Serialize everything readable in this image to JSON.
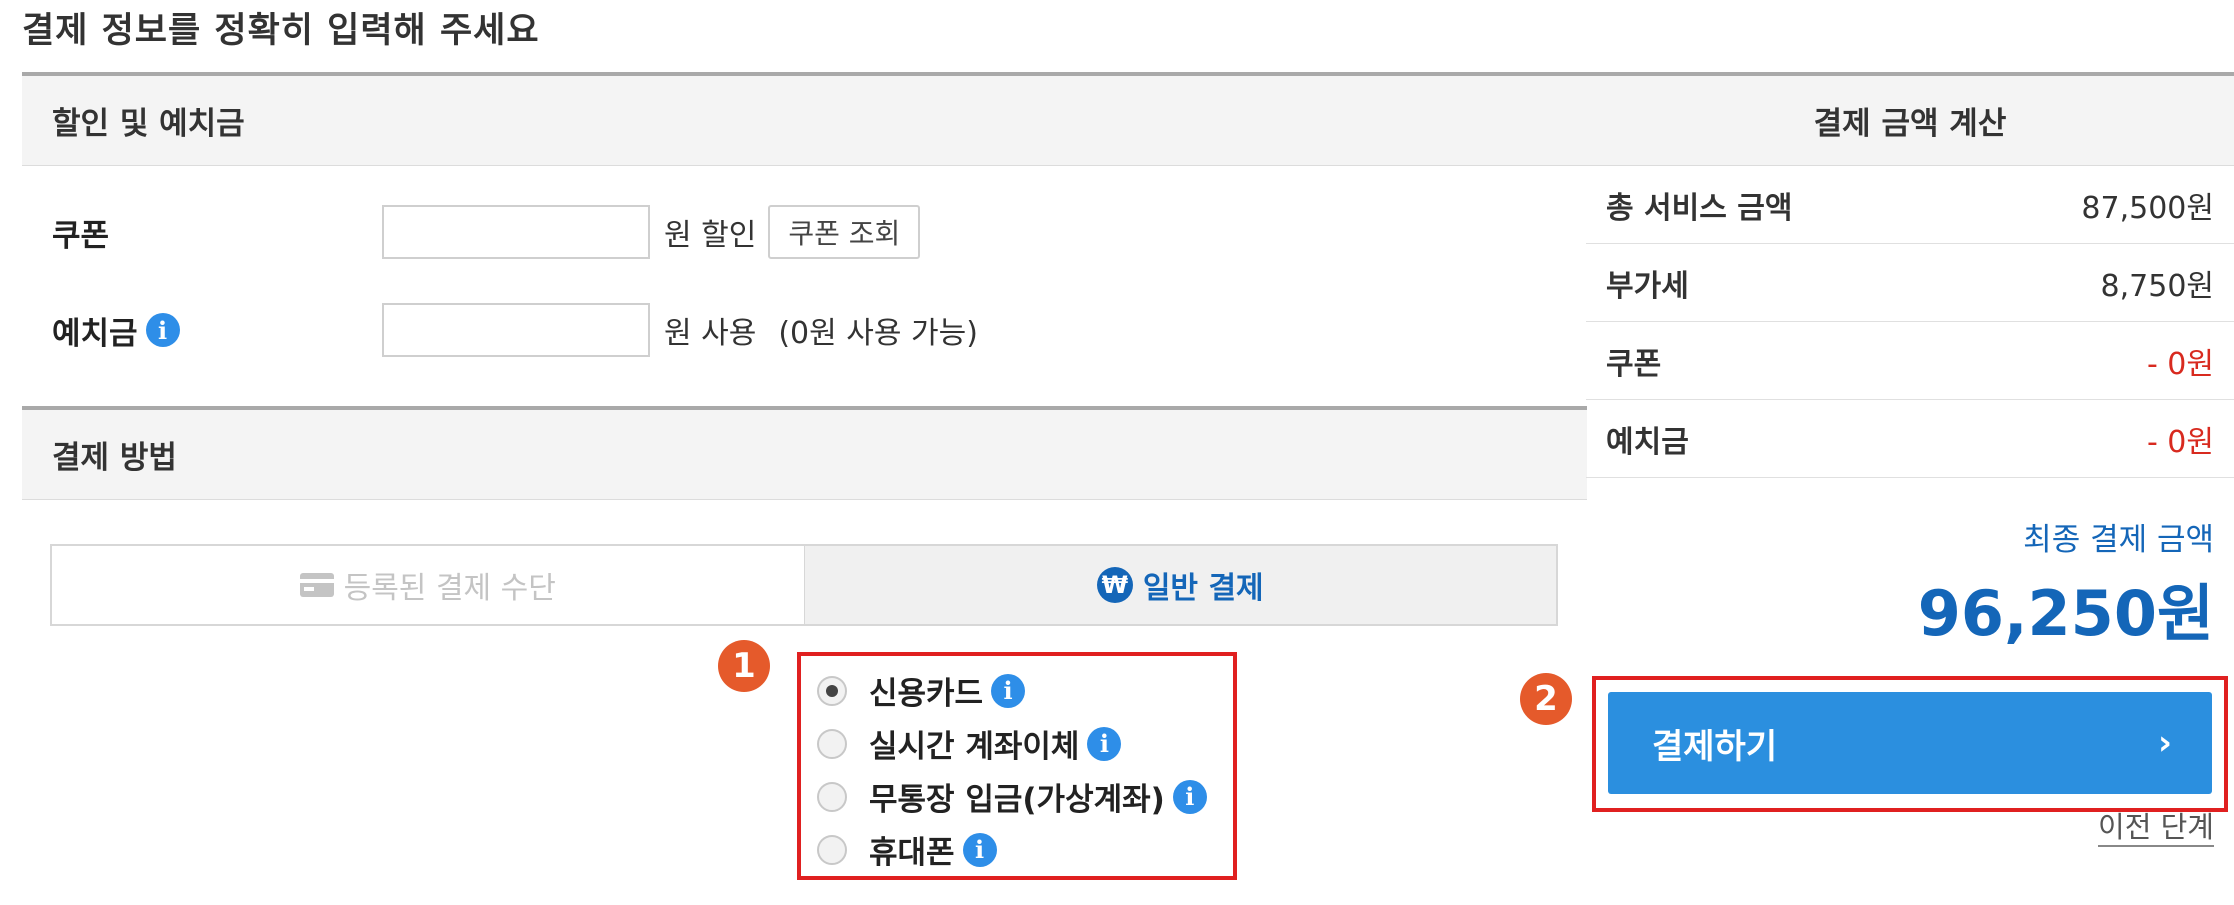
{
  "page_title": "결제 정보를 정확히 입력해 주세요",
  "discount_section": {
    "title": "할인 및 예치금",
    "coupon": {
      "label": "쿠폰",
      "value": "",
      "suffix": "원 할인",
      "button_label": "쿠폰 조회"
    },
    "deposit": {
      "label": "예치금",
      "value": "",
      "suffix": "원 사용",
      "note": "(0원 사용 가능)"
    }
  },
  "payment_section": {
    "title": "결제 방법",
    "tabs": [
      {
        "label": "등록된 결제 수단",
        "active": false
      },
      {
        "label": "일반 결제",
        "active": true
      }
    ],
    "methods": [
      {
        "label": "신용카드",
        "checked": true
      },
      {
        "label": "실시간 계좌이체",
        "checked": false
      },
      {
        "label": "무통장 입금(가상계좌)",
        "checked": false
      },
      {
        "label": "휴대폰",
        "checked": false
      }
    ]
  },
  "summary": {
    "title": "결제 금액 계산",
    "rows": [
      {
        "label": "총 서비스 금액",
        "value": "87,500원"
      },
      {
        "label": "부가세",
        "value": "8,750원"
      },
      {
        "label": "쿠폰",
        "value": "- 0원"
      },
      {
        "label": "예치금",
        "value": "- 0원"
      }
    ],
    "final_label": "최종 결제 금액",
    "final_amount": "96,250원",
    "pay_button_label": "결제하기",
    "pay_button_arrow": "›",
    "prev_link": "이전 단계"
  },
  "annotations": {
    "badge_1": "1",
    "badge_2": "2"
  },
  "icons": {
    "info": "info-icon",
    "card": "card-icon",
    "won": "won-icon",
    "info_glyph": "i",
    "won_glyph": "₩"
  },
  "colors": {
    "accent_blue": "#1466b8",
    "button_blue": "#2b8fdf",
    "highlight_red": "#e02020",
    "badge_orange": "#e55a2b",
    "negative_red": "#d82a1f"
  }
}
